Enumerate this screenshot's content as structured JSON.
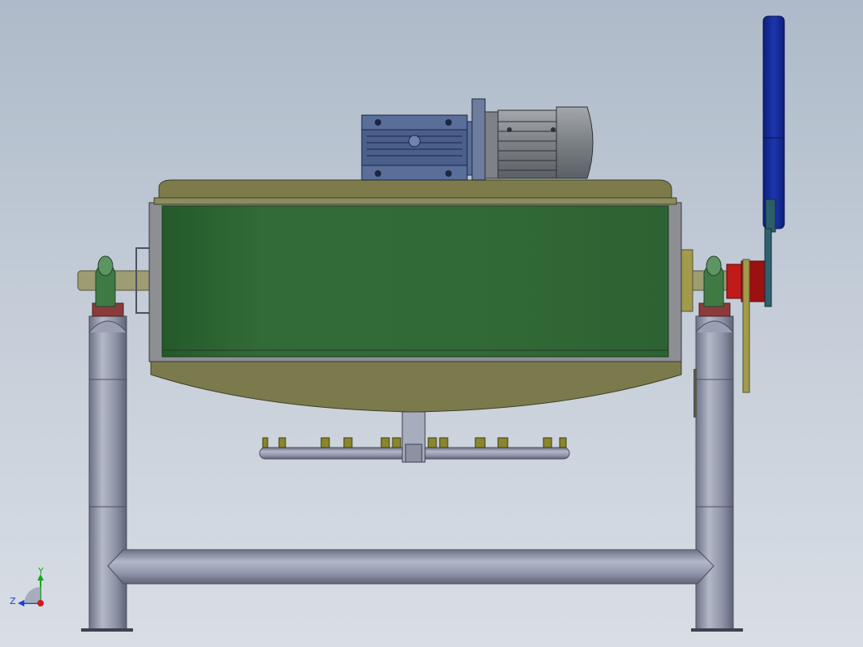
{
  "viewport": {
    "background_top": "#aebac9",
    "background_bottom": "#d9dee5"
  },
  "model": {
    "colors": {
      "tank_body": "#2f6a35",
      "tank_shell": "#7c7a4c",
      "tank_shell_dark": "#5d5c34",
      "motor_blue": "#4a5f8c",
      "motor_gray": "#8b8f95",
      "frame_pipe": "#8d93a6",
      "handle_blue": "#1a2f9f",
      "bearing_red": "#b01818",
      "support_green": "#3f7a45"
    },
    "parts": [
      "gear-reducer",
      "electric-motor",
      "kettle-body",
      "lid",
      "stirrer-bar",
      "frame-stand",
      "tilt-handle",
      "trunnion-bearing"
    ]
  },
  "triad": {
    "x_label": "",
    "y_label": "Y",
    "z_label": "Z",
    "y_color": "#1aa51a",
    "z_color": "#1a3fd6",
    "x_color": "#d61a1a"
  }
}
